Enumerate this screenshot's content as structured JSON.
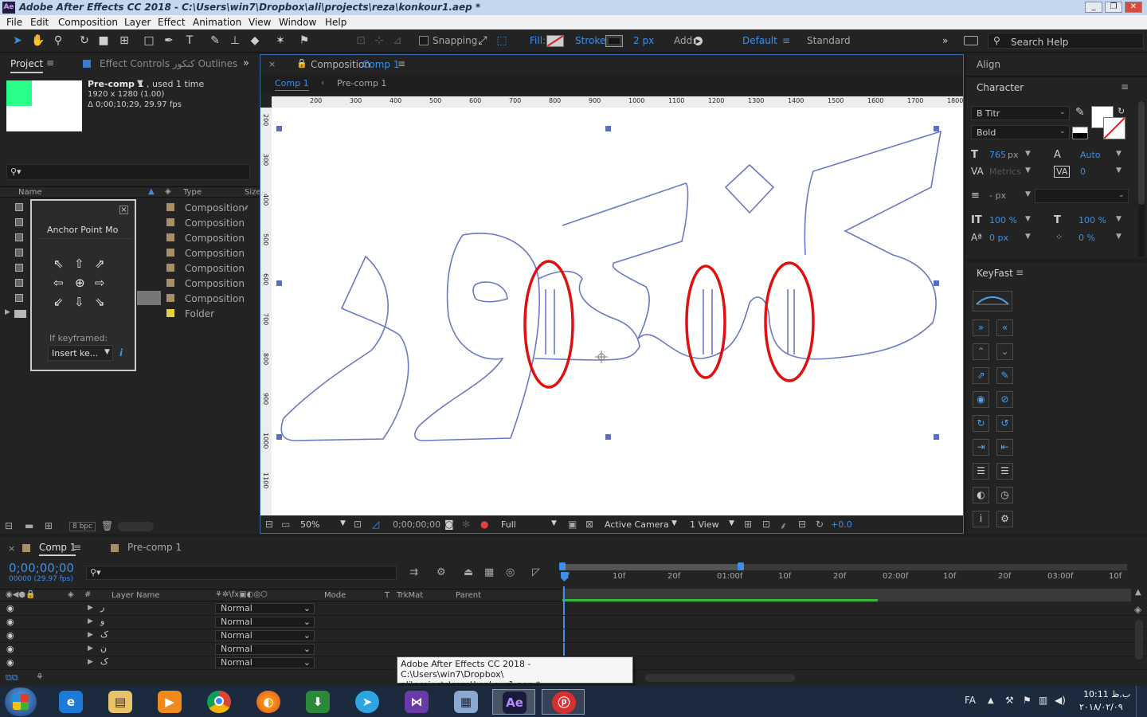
{
  "window": {
    "title": "Adobe After Effects CC 2018 - C:\\Users\\win7\\Dropbox\\ali\\projects\\reza\\konkour1.aep *",
    "app_icon": "Ae",
    "controls": [
      "minimize-icon",
      "restore-icon",
      "close-icon"
    ]
  },
  "menu": [
    "File",
    "Edit",
    "Composition",
    "Layer",
    "Effect",
    "Animation",
    "View",
    "Window",
    "Help"
  ],
  "toolbar": {
    "snapping_label": "Snapping",
    "fill_label": "Fill:",
    "stroke_label": "Stroke:",
    "stroke_width": "2 px",
    "add_label": "Add:",
    "workspace_default": "Default",
    "workspace_standard": "Standard",
    "search_placeholder": "Search Help"
  },
  "project_panel": {
    "tab_project": "Project",
    "tab_effect_controls": "Effect Controls کنکور Outlines",
    "item_name": "Pre-comp 1",
    "item_used": ", used 1 time",
    "item_size": "1920 x 1280 (1.00)",
    "item_duration": "Δ 0;00;10;29, 29.97 fps",
    "col_name": "Name",
    "col_type": "Type",
    "col_size": "Size",
    "rows": [
      {
        "type": "Composition",
        "color": "#a88f6a"
      },
      {
        "type": "Composition",
        "color": "#a88f6a"
      },
      {
        "type": "Composition",
        "color": "#a88f6a"
      },
      {
        "type": "Composition",
        "color": "#a88f6a"
      },
      {
        "type": "Composition",
        "color": "#a88f6a"
      },
      {
        "type": "Composition",
        "color": "#a88f6a"
      },
      {
        "type": "Composition",
        "color": "#a88f6a"
      },
      {
        "type": "Folder",
        "color": "#e6d23c"
      }
    ],
    "bpc": "8 bpc"
  },
  "anchor_popup": {
    "title": "Anchor Point Mo",
    "if_keyframed": "If keyframed:",
    "insert_label": "Insert ke...",
    "info": "i"
  },
  "composition_panel": {
    "tab_label": "Composition",
    "tab_comp": "Comp 1",
    "breadcrumb_comp": "Comp 1",
    "breadcrumb_precomp": "Pre-comp 1",
    "ruler": [
      "200",
      "300",
      "400",
      "500",
      "600",
      "700",
      "800",
      "900",
      "1000",
      "1100",
      "1200",
      "1300",
      "1400",
      "1500",
      "1600",
      "1700",
      "1800"
    ],
    "vruler": [
      "200",
      "300",
      "400",
      "500",
      "600",
      "700",
      "800",
      "900",
      "1000",
      "1100"
    ],
    "zoom": "50%",
    "timecode": "0;00;00;00",
    "resolution": "Full",
    "camera": "Active Camera",
    "views": "1 View",
    "exposure": "+0.0"
  },
  "align_panel": {
    "title": "Align"
  },
  "character_panel": {
    "title": "Character",
    "font": "B Titr",
    "style": "Bold",
    "font_size": "765",
    "font_size_unit": "px",
    "leading": "Auto",
    "kerning": "Metrics",
    "tracking": "0",
    "stroke_px": "- px",
    "vert_scale": "100 %",
    "horiz_scale": "100 %",
    "baseline": "0 px",
    "tsume": "0 %"
  },
  "keyfast_panel": {
    "title": "KeyFast"
  },
  "timeline": {
    "tab_comp": "Comp 1",
    "tab_precomp": "Pre-comp 1",
    "timecode": "0;00;00;00",
    "frames": "00000 (29.97 fps)",
    "col_layer_name": "Layer Name",
    "col_mode": "Mode",
    "col_t": "T",
    "col_trkmat": "TrkMat",
    "col_parent": "Parent",
    "ruler": [
      "0f",
      "10f",
      "20f",
      "01:00f",
      "10f",
      "20f",
      "02:00f",
      "10f",
      "20f",
      "03:00f",
      "10f"
    ],
    "layers": [
      {
        "name": "ر",
        "mode": "Normal"
      },
      {
        "name": "و",
        "mode": "Normal"
      },
      {
        "name": "ک",
        "mode": "Normal"
      },
      {
        "name": "ن",
        "mode": "Normal"
      },
      {
        "name": "ک",
        "mode": "Normal"
      }
    ],
    "tooltip_line1": "Adobe After Effects CC 2018 - C:\\Users\\win7\\Dropbox\\",
    "tooltip_line2": "ali\\projects\\reza\\konkour1.aep *"
  },
  "taskbar": {
    "lang": "FA",
    "time": "10:11 ب.ظ",
    "date": "۲۰۱۸/۰۲/۰۹",
    "apps": [
      "ie-icon",
      "explorer-icon",
      "media-player-icon",
      "chrome-icon",
      "firefox-icon",
      "idm-icon",
      "telegram-icon",
      "visual-studio-icon",
      "calculator-icon",
      "after-effects-icon",
      "psiphon-icon"
    ]
  }
}
